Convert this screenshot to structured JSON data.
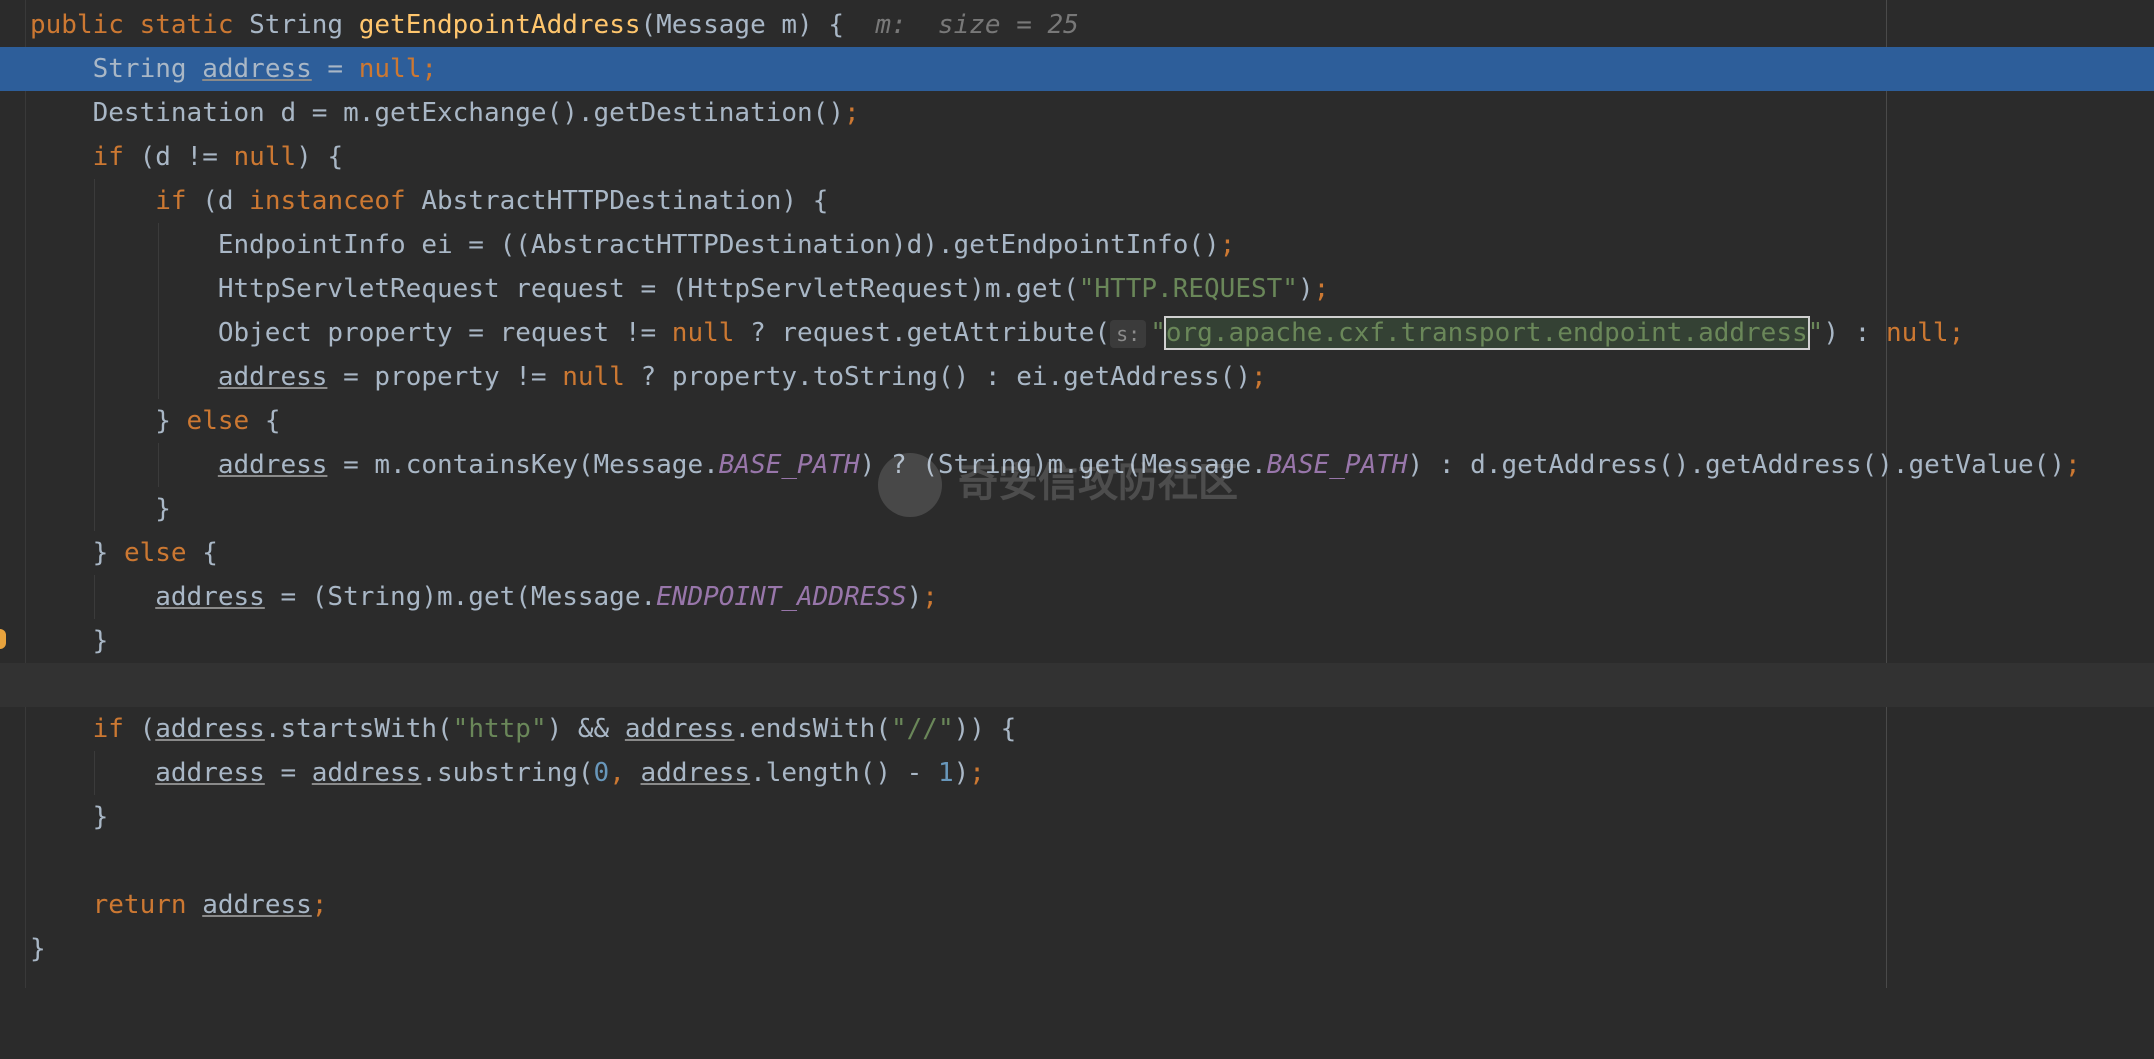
{
  "editor": {
    "inlay_method_hint": "m:  size = 25",
    "param_hint": "s:",
    "watermark": "奇安信攻防社区",
    "lines": [
      [
        "public ",
        "static ",
        "String ",
        "getEndpointAddress",
        "(Message m) {"
      ],
      [
        "String ",
        "address",
        " = ",
        "null",
        ";"
      ],
      [
        "Destination d = m.getExchange().getDestination()",
        ";"
      ],
      [
        "if ",
        "(d != ",
        "null",
        ") {"
      ],
      [
        "if ",
        "(d ",
        "instanceof ",
        "AbstractHTTPDestination) {"
      ],
      [
        "EndpointInfo ei = ((AbstractHTTPDestination)d).getEndpointInfo()",
        ";"
      ],
      [
        "HttpServletRequest request = (HttpServletRequest)m.get(",
        "\"HTTP.REQUEST\"",
        ")",
        ";"
      ],
      [
        "Object property = request != ",
        "null",
        " ? request.getAttribute(",
        "\"",
        "org.apache.cxf.transport.endpoint.address",
        "\"",
        ") : ",
        "null",
        ";"
      ],
      [
        "address",
        " = property != ",
        "null",
        " ? property.toString() : ei.getAddress()",
        ";"
      ],
      [
        "} ",
        "else ",
        "{"
      ],
      [
        "address",
        " = m.containsKey(Message.",
        "BASE_PATH",
        ") ? (String)m.get(Message.",
        "BASE_PATH",
        ") : d.getAddress().getAddress().getValue()",
        ";"
      ],
      [
        "}"
      ],
      [
        "} ",
        "else ",
        "{"
      ],
      [
        "address",
        " = (String)m.get(Message.",
        "ENDPOINT_ADDRESS",
        ")",
        ";"
      ],
      [
        "}"
      ],
      [
        ""
      ],
      [
        "if ",
        "(",
        "address",
        ".startsWith(",
        "\"http\"",
        ") && ",
        "address",
        ".endsWith(",
        "\"//\"",
        ")) {"
      ],
      [
        "address",
        " = ",
        "address",
        ".substring(",
        "0",
        ", ",
        "address",
        ".length() - ",
        "1",
        ")",
        ";"
      ],
      [
        "}"
      ],
      [
        ""
      ],
      [
        "return ",
        "address",
        ";"
      ],
      [
        "}"
      ]
    ]
  }
}
